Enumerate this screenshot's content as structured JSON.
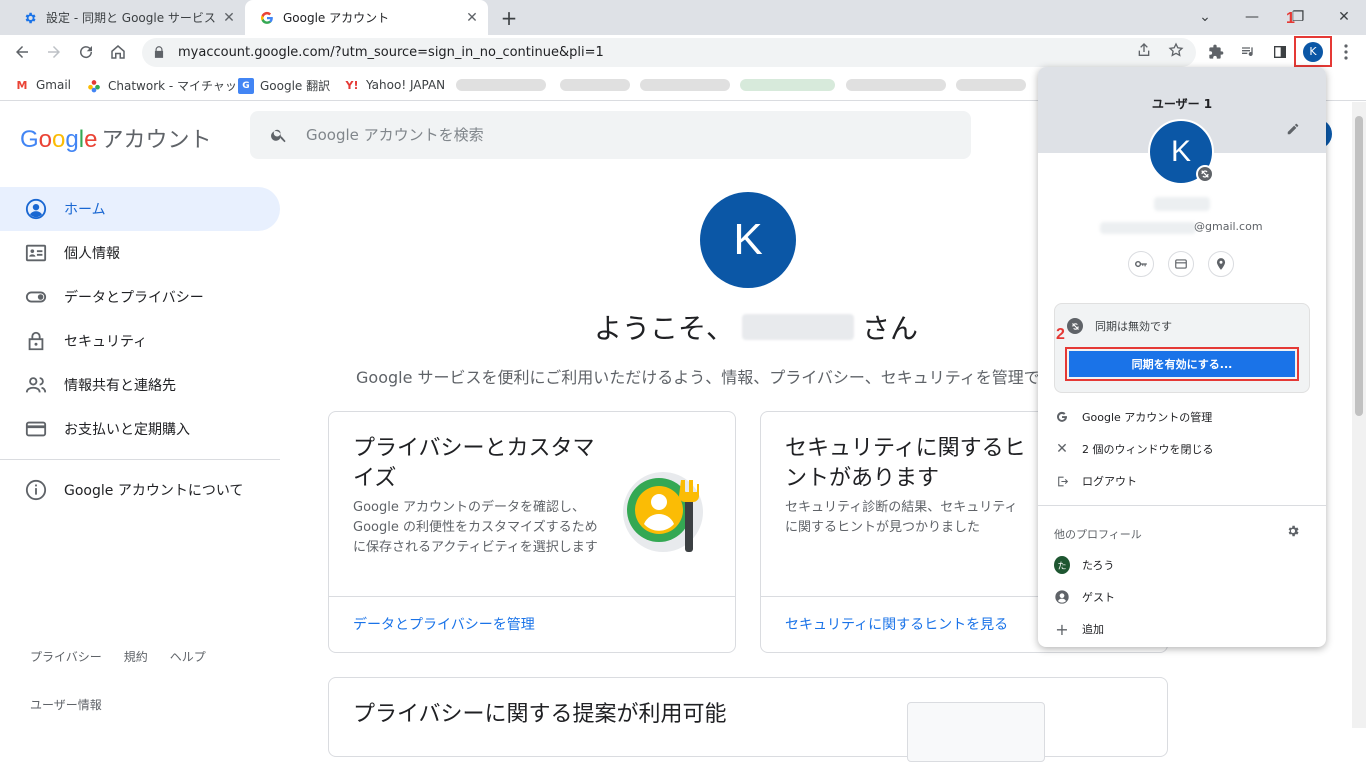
{
  "browser": {
    "tabs": [
      {
        "title": "設定 - 同期と Google サービス",
        "icon": "gear-icon"
      },
      {
        "title": "Google アカウント",
        "icon": "google-g-icon"
      }
    ],
    "url": "myaccount.google.com/?utm_source=sign_in_no_continue&pli=1",
    "profile_initial": "K",
    "bookmarks": [
      {
        "label": "Gmail",
        "icon": "gmail-icon"
      },
      {
        "label": "Chatwork - マイチャット",
        "icon": "chatwork-icon"
      },
      {
        "label": "Google 翻訳",
        "icon": "translate-icon"
      },
      {
        "label": "Yahoo! JAPAN",
        "icon": "yahoo-icon"
      }
    ]
  },
  "page": {
    "logo_google": "Google",
    "logo_app": "アカウント",
    "search_placeholder": "Google アカウントを検索",
    "nav": [
      {
        "label": "ホーム",
        "icon": "account-circle-icon",
        "active": true
      },
      {
        "label": "個人情報",
        "icon": "id-card-icon"
      },
      {
        "label": "データとプライバシー",
        "icon": "toggle-icon"
      },
      {
        "label": "セキュリティ",
        "icon": "lock-icon"
      },
      {
        "label": "情報共有と連絡先",
        "icon": "people-icon"
      },
      {
        "label": "お支払いと定期購入",
        "icon": "credit-card-icon"
      }
    ],
    "nav_about": "Google アカウントについて",
    "footer_links": [
      "プライバシー",
      "規約",
      "ヘルプ"
    ],
    "footer_userinfo": "ユーザー情報",
    "avatar_initial": "K",
    "welcome_prefix": "ようこそ、",
    "welcome_suffix": "さん",
    "subtitle": "Google サービスを便利にご利用いただけるよう、情報、プライバシー、セキュリティを管理で",
    "cards": [
      {
        "title": "プライバシーとカスタマイズ",
        "desc": "Google アカウントのデータを確認し、Google の利便性をカスタマイズするために保存されるアクティビティを選択します",
        "link": "データとプライバシーを管理"
      },
      {
        "title": "セキュリティに関するヒントがあります",
        "desc": "セキュリティ診断の結果、セキュリティに関するヒントが見つかりました",
        "link": "セキュリティに関するヒントを見る"
      },
      {
        "title": "プライバシーに関する提案が利用可能"
      }
    ]
  },
  "popup": {
    "user_name": "ユーザー 1",
    "avatar_initial": "K",
    "email_suffix": "@gmail.com",
    "sync_status": "同期は無効です",
    "sync_button": "同期を有効にする...",
    "menu": [
      {
        "label": "Google アカウントの管理",
        "icon": "google-g-icon"
      },
      {
        "label": "2 個のウィンドウを閉じる",
        "icon": "close-icon"
      },
      {
        "label": "ログアウト",
        "icon": "logout-icon"
      }
    ],
    "other_profiles_title": "他のプロフィール",
    "profiles": [
      {
        "label": "たろう",
        "initial": "た"
      },
      {
        "label": "ゲスト",
        "icon": "guest-icon"
      },
      {
        "label": "追加",
        "icon": "plus-icon"
      }
    ]
  },
  "markers": {
    "step1": "1",
    "step2": "2"
  },
  "colors": {
    "accent": "#1a73e8",
    "avatar": "#0b57a6",
    "highlight": "#e53935"
  }
}
